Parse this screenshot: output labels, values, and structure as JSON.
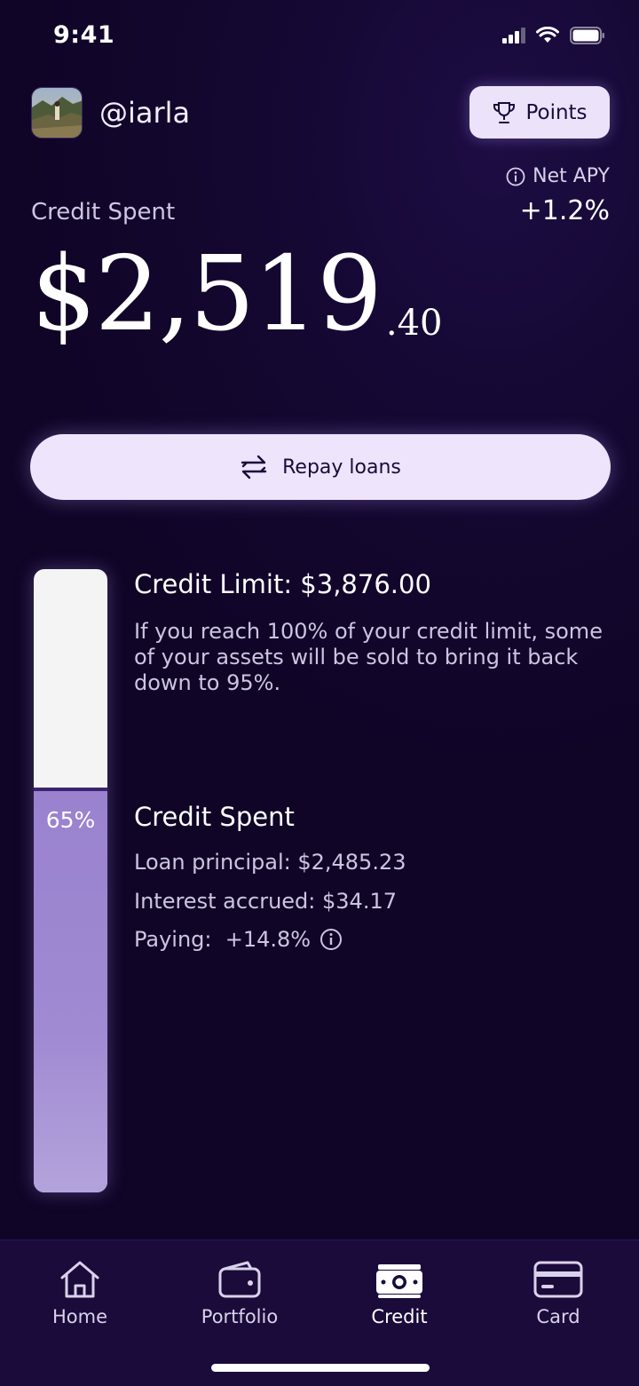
{
  "status_bar": {
    "time": "9:41"
  },
  "header": {
    "username": "@iarla",
    "points_label": "Points",
    "net_apy_label": "Net APY",
    "net_apy_value": "+1.2%"
  },
  "summary": {
    "label": "Credit Spent",
    "amount_main": "$2,519",
    "amount_cents": ".40"
  },
  "repay_button": {
    "label": "Repay loans"
  },
  "gauge": {
    "used_fraction": 0.65,
    "percent_label": "65%"
  },
  "credit_limit": {
    "title": "Credit Limit: $3,876.00",
    "description": "If you reach 100% of your credit limit, some of your assets will be sold to bring it back down to 95%."
  },
  "credit_spent": {
    "title": "Credit Spent",
    "principal": "Loan principal: $2,485.23",
    "interest": "Interest accrued: $34.17",
    "paying": "Paying:  +14.8%"
  },
  "nav": {
    "items": [
      {
        "label": "Home",
        "icon": "home-icon"
      },
      {
        "label": "Portfolio",
        "icon": "wallet-icon"
      },
      {
        "label": "Credit",
        "icon": "cash-icon",
        "active": true
      },
      {
        "label": "Card",
        "icon": "card-icon"
      }
    ]
  },
  "colors": {
    "background": "#12062b",
    "accent_light": "#eee4fb",
    "gauge_fill": "#9a82cf",
    "nav_bg": "#1a0b3b"
  }
}
